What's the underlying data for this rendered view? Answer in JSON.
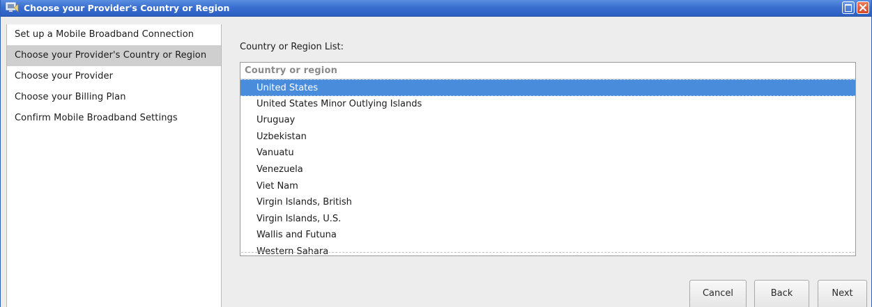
{
  "window": {
    "title": "Choose your Provider's Country or Region",
    "title_icon": "network-wizard-icon"
  },
  "sidebar": {
    "steps": [
      {
        "label": "Set up a Mobile Broadband Connection",
        "active": false
      },
      {
        "label": "Choose your Provider's Country or Region",
        "active": true
      },
      {
        "label": "Choose your Provider",
        "active": false
      },
      {
        "label": "Choose your Billing Plan",
        "active": false
      },
      {
        "label": "Confirm Mobile Broadband Settings",
        "active": false
      }
    ]
  },
  "main": {
    "list_label": "Country or Region List:",
    "column_header": "Country or region",
    "items": [
      "United States",
      "United States Minor Outlying Islands",
      "Uruguay",
      "Uzbekistan",
      "Vanuatu",
      "Venezuela",
      "Viet Nam",
      "Virgin Islands, British",
      "Virgin Islands, U.S.",
      "Wallis and Futuna",
      "Western Sahara"
    ],
    "selected_index": 0
  },
  "buttons": {
    "cancel": "Cancel",
    "back": "Back",
    "next": "Next"
  },
  "colors": {
    "titlebar": "#3a6fd0",
    "selection": "#4a8cdc",
    "active_step": "#cfcfcf"
  }
}
